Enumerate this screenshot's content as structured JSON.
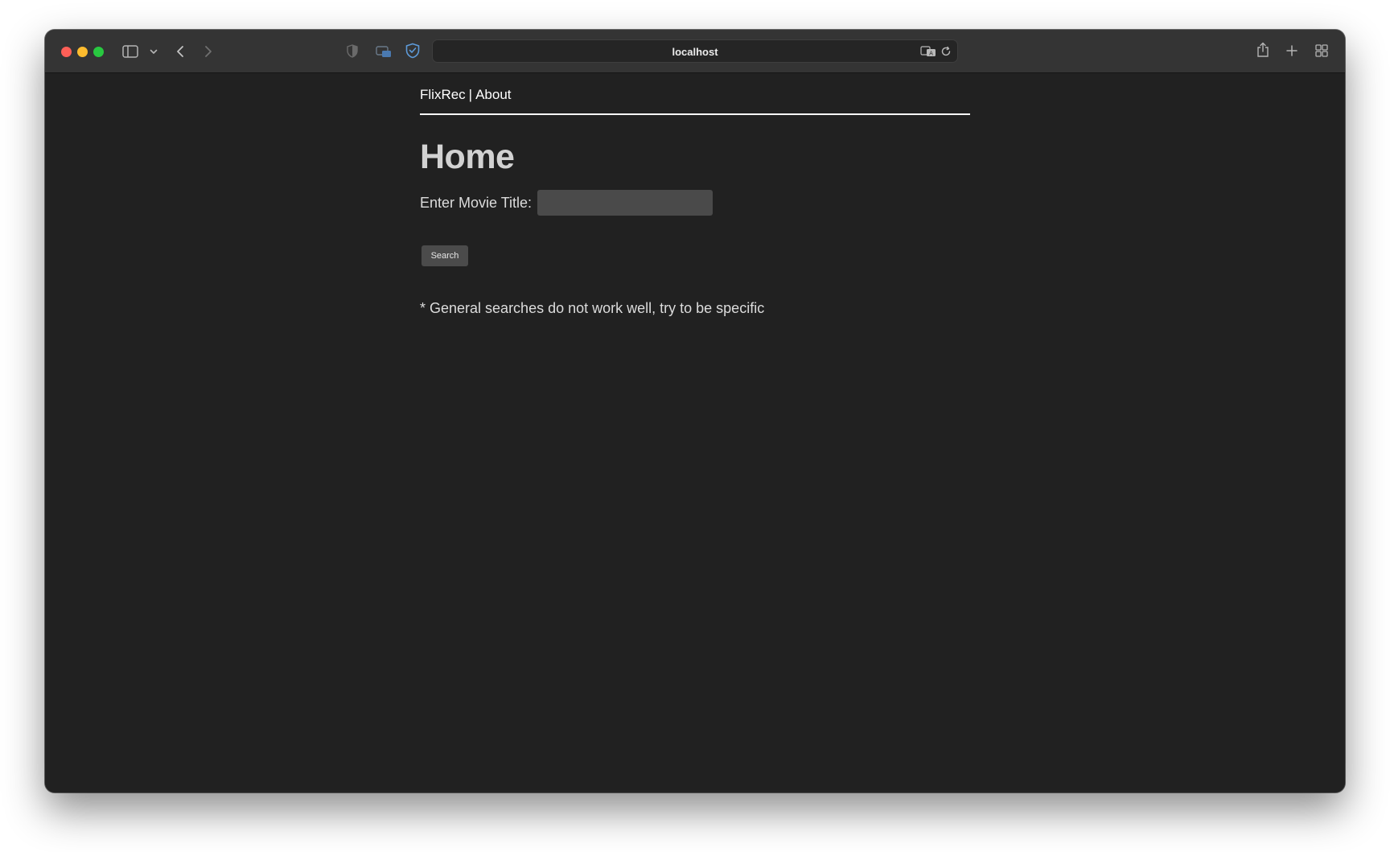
{
  "browser": {
    "address": "localhost"
  },
  "nav": {
    "brand": "FlixRec",
    "separator": "|",
    "about": "About"
  },
  "main": {
    "heading": "Home",
    "field_label": "Enter Movie Title:",
    "input_value": "",
    "input_placeholder": "",
    "search_label": "Search",
    "note": "* General searches do not work well, try to be specific"
  },
  "icons": {
    "shield": "shield-icon",
    "sidebar": "sidebar-toggle-icon",
    "back": "back-icon",
    "forward": "forward-icon",
    "translate": "translate-icon",
    "reload": "reload-icon",
    "share": "share-icon",
    "new_tab": "plus-icon",
    "tab_overview": "tab-overview-icon"
  }
}
